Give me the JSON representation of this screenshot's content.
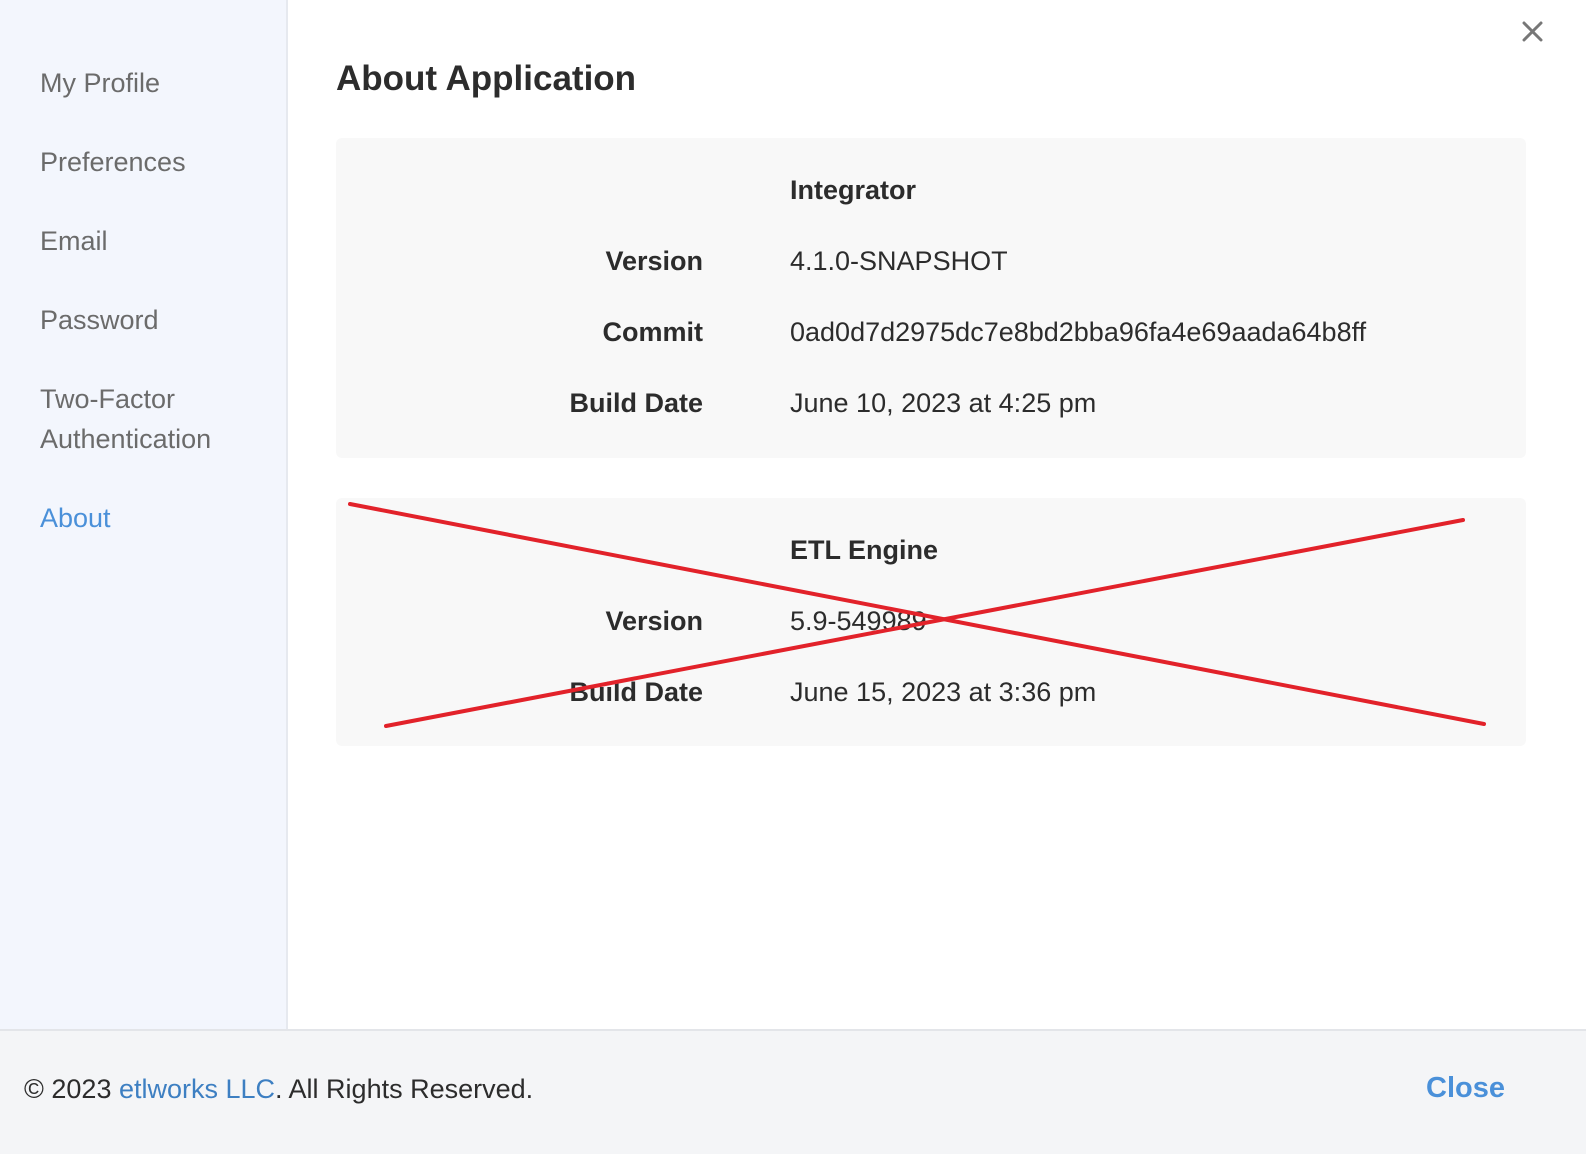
{
  "dialog": {
    "title": "About Application",
    "close_icon": "close-icon"
  },
  "sidebar": {
    "items": [
      {
        "label": "My Profile",
        "active": false
      },
      {
        "label": "Preferences",
        "active": false
      },
      {
        "label": "Email",
        "active": false
      },
      {
        "label": "Password",
        "active": false
      },
      {
        "label": "Two-Factor Authentication",
        "active": false
      },
      {
        "label": "About",
        "active": true
      }
    ]
  },
  "integrator": {
    "title": "Integrator",
    "rows": [
      {
        "label": "Version",
        "value": "4.1.0-SNAPSHOT"
      },
      {
        "label": "Commit",
        "value": "0ad0d7d2975dc7e8bd2bba96fa4e69aada64b8ff"
      },
      {
        "label": "Build Date",
        "value": "June 10, 2023 at 4:25 pm"
      }
    ]
  },
  "etl_engine": {
    "title": "ETL Engine",
    "rows": [
      {
        "label": "Version",
        "value": "5.9-549989"
      },
      {
        "label": "Build Date",
        "value": "June 15, 2023 at 3:36 pm"
      }
    ],
    "crossed_out": true,
    "cross_color": "#e2222a"
  },
  "footer": {
    "copyright_prefix": "© 2023 ",
    "company_link": "etlworks LLC",
    "copyright_suffix": ". All Rights Reserved.",
    "close_label": "Close"
  },
  "colors": {
    "accent": "#4a90d9",
    "sidebar_bg": "#f3f6fd",
    "panel_bg": "#f8f8f8"
  }
}
